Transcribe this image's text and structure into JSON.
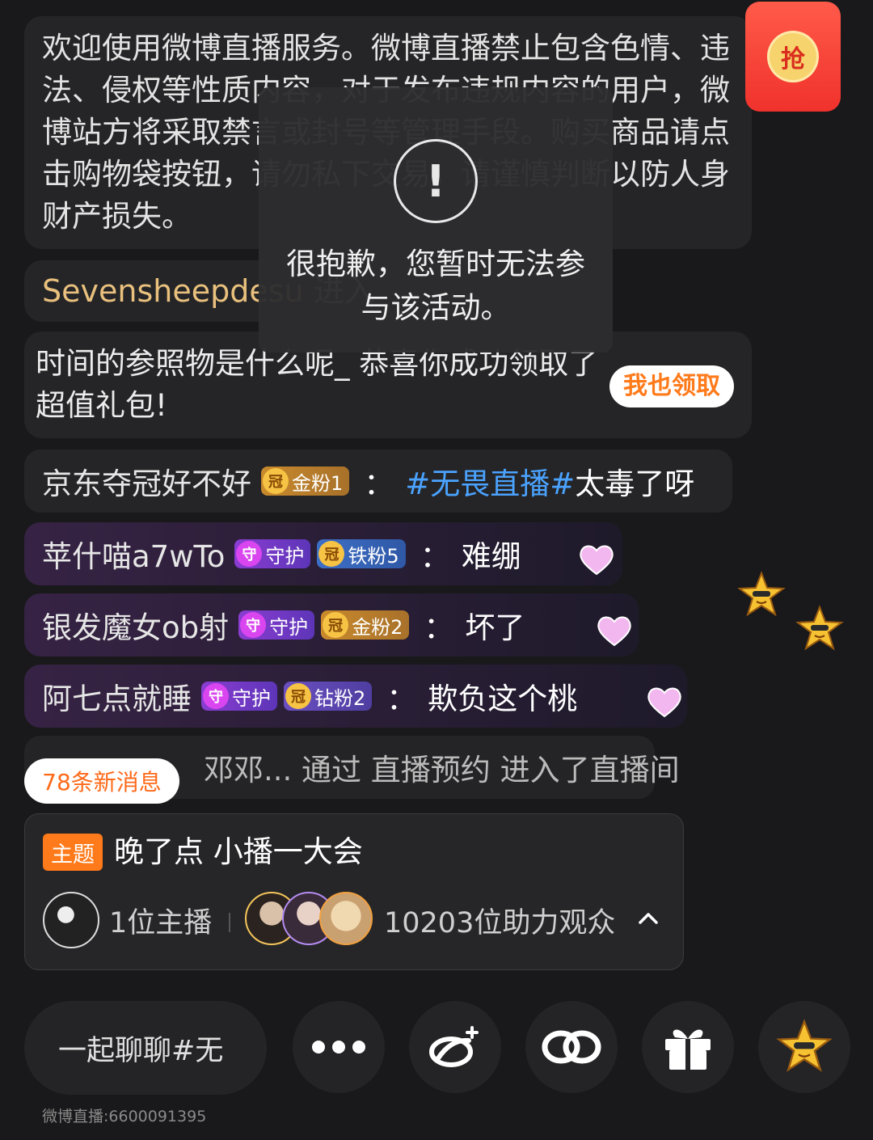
{
  "system_notice": "欢迎使用微博直播服务。微博直播禁止包含色情、违法、侵权等性质内容，对于发布违规内容的用户，微博站方将采取禁言或封号等管理手段。购买商品请点击购物袋按钮，请勿私下交易，请谨慎判断以防人身财产损失。",
  "enter_message": {
    "username": "Sevensheepdesu",
    "action": "进入"
  },
  "gift_message": {
    "text": "时间的参照物是什么呢_ 恭喜你成功领取了超值礼包!",
    "button": "我也领取"
  },
  "chat": [
    {
      "username": "京东夺冠好不好",
      "badges": [
        {
          "type": "gold",
          "label": "金粉1"
        }
      ],
      "colon": "：",
      "tag": "#无畏直播#",
      "message": "太毒了呀"
    },
    {
      "username": "苹什喵a7wTo",
      "badges": [
        {
          "type": "guard",
          "label": "守护"
        },
        {
          "type": "iron",
          "label": "铁粉5"
        }
      ],
      "colon": "：",
      "message": "难绷"
    },
    {
      "username": "银发魔女ob射",
      "badges": [
        {
          "type": "guard",
          "label": "守护"
        },
        {
          "type": "gold",
          "label": "金粉2"
        }
      ],
      "colon": "：",
      "message": "坏了"
    },
    {
      "username": "阿七点就睡",
      "badges": [
        {
          "type": "guard",
          "label": "守护"
        },
        {
          "type": "diamond",
          "label": "钻粉2"
        }
      ],
      "colon": "：",
      "message": "欺负这个桃"
    },
    {
      "text": "邓邓... 通过 直播预约 进入了直播间"
    }
  ],
  "badge_icons": {
    "guard": "守",
    "gold": "冠",
    "iron": "冠",
    "diamond": "冠"
  },
  "toast": {
    "icon": "!",
    "message": "很抱歉，您暂时无法参与该活动。"
  },
  "red_packet": {
    "label": "抢"
  },
  "new_messages_label": "78条新消息",
  "topic": {
    "tag": "主题",
    "title": "晚了点 小播一大会",
    "host_count": "1位主播",
    "audience_count": "10203位助力观众"
  },
  "bottom": {
    "input_placeholder": "一起聊聊#无",
    "buttons": [
      "more-icon",
      "weibo-share-icon",
      "link-icon",
      "gift-icon",
      "star-mascot-icon"
    ]
  },
  "footer_id": "微博直播:6600091395",
  "colors": {
    "accent_orange": "#ff7a1a",
    "username_gold": "#e9c07d",
    "hashtag_blue": "#4aa3ff",
    "background": "#19191b"
  }
}
